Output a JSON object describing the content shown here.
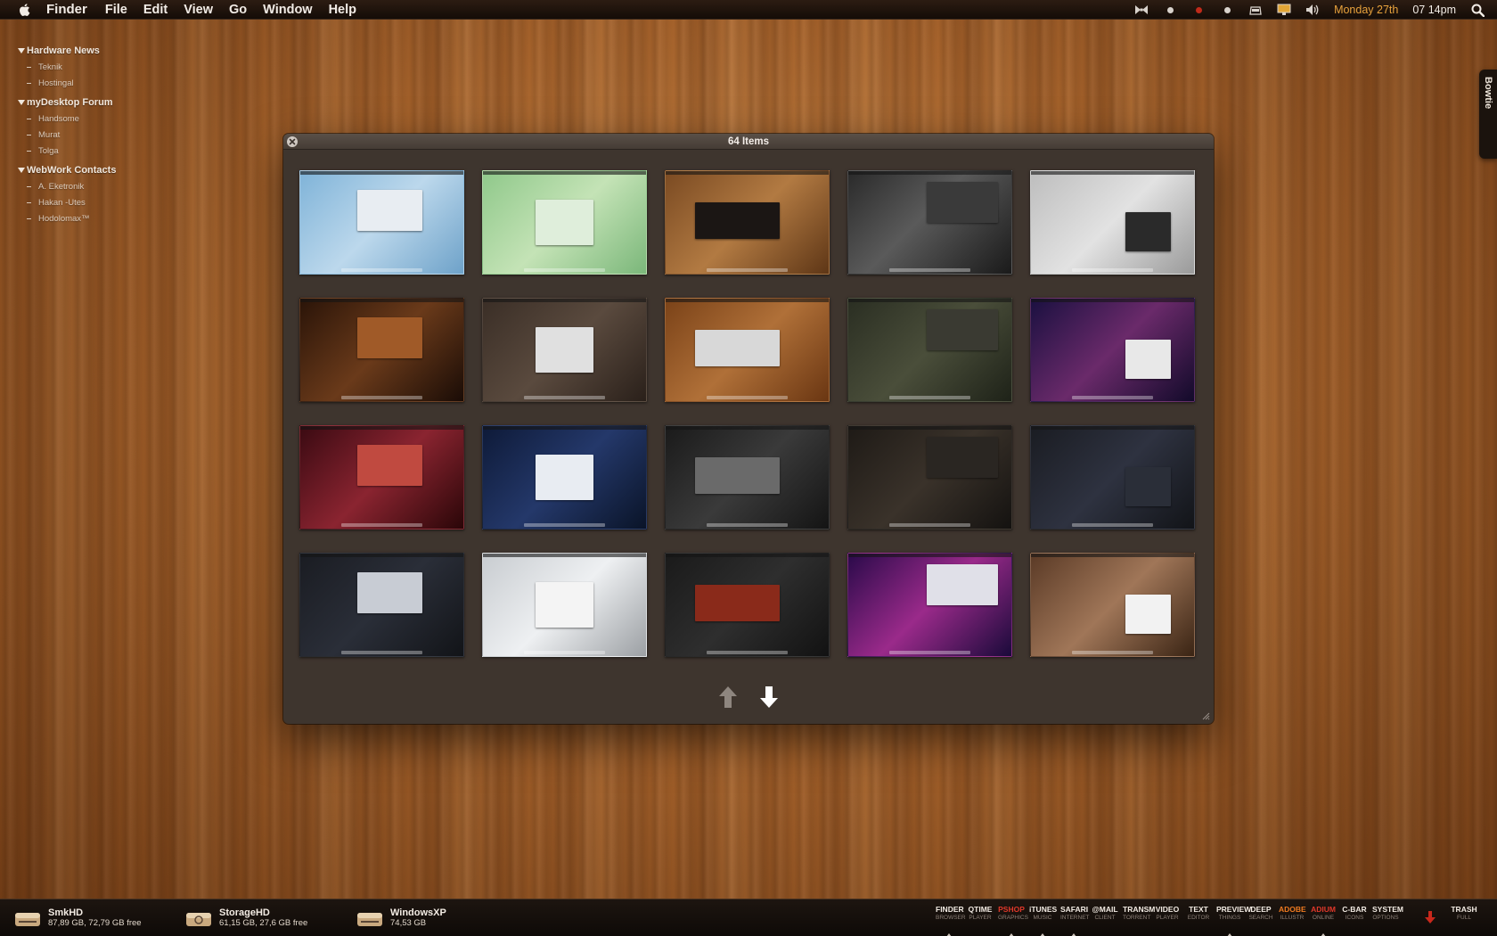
{
  "menubar": {
    "app": "Finder",
    "items": [
      "File",
      "Edit",
      "View",
      "Go",
      "Window",
      "Help"
    ],
    "date": "Monday 27th",
    "time": "07 14pm"
  },
  "sidebar": {
    "groups": [
      {
        "title": "Hardware News",
        "items": [
          "Teknik",
          "Hostingal"
        ]
      },
      {
        "title": "myDesktop Forum",
        "items": [
          "Handsome",
          "Murat",
          "Tolga"
        ]
      },
      {
        "title": "WebWork Contacts",
        "items": [
          "A. Eketronik",
          "Hakan -Utes",
          "Hodolomax™"
        ]
      }
    ]
  },
  "bowtie": {
    "label": "Bowtie"
  },
  "window": {
    "title": "64 Items"
  },
  "disks": [
    {
      "name": "SmkHD",
      "info": "87,89 GB, 72,79 GB free"
    },
    {
      "name": "StorageHD",
      "info": "61,15 GB, 27,6 GB free"
    },
    {
      "name": "WindowsXP",
      "info": "74,53 GB"
    }
  ],
  "dock": [
    {
      "n1": "FINDER",
      "n2": "BROWSER",
      "ind": true
    },
    {
      "n1": "QTIME",
      "n2": "PLAYER",
      "ind": false
    },
    {
      "n1": "PSHOP",
      "n2": "GRAPHICS",
      "ind": true,
      "color": "red"
    },
    {
      "n1": "iTUNES",
      "n2": "MUSIC",
      "ind": true
    },
    {
      "n1": "SAFARI",
      "n2": "INTERNET",
      "ind": true
    },
    {
      "n1": "@MAIL",
      "n2": "CLIENT",
      "ind": false
    },
    {
      "n1": "TRANSM",
      "n2": "TORRENT",
      "ind": false
    },
    {
      "n1": "VIDEO",
      "n2": "PLAYER",
      "ind": false
    },
    {
      "n1": "TEXT",
      "n2": "EDITOR",
      "ind": false
    },
    {
      "n1": "PREVIEW",
      "n2": "THINGS",
      "ind": true
    },
    {
      "n1": "DEEP",
      "n2": "SEARCH",
      "ind": false
    },
    {
      "n1": "ADOBE",
      "n2": "ILLUSTR",
      "ind": false,
      "color": "orange"
    },
    {
      "n1": "ADIUM",
      "n2": "ONLINE",
      "ind": true,
      "color": "red"
    },
    {
      "n1": "C-BAR",
      "n2": "ICONS",
      "ind": false
    },
    {
      "n1": "SYSTEM",
      "n2": "OPTIONS",
      "ind": false
    }
  ],
  "trash": {
    "n1": "TRASH",
    "n2": "FULL"
  },
  "thumbnails": [
    {
      "bg": "linear-gradient(135deg,#7fb3d8,#bcd8ec 50%,#6ea2c9)",
      "win": "#e8edf2"
    },
    {
      "bg": "linear-gradient(135deg,#8fc88a,#c4e3b6 50%,#7bb77a)",
      "win": "#dfeedb"
    },
    {
      "bg": "linear-gradient(135deg,#7a4a22,#b27a42 50%,#5e3616)",
      "win": "#1b1614"
    },
    {
      "bg": "linear-gradient(135deg,#2a2a2a,#5a5a5a 45%,#1a1a1a)",
      "win": "#3a3a3a"
    },
    {
      "bg": "linear-gradient(135deg,#bdbdbd,#e2e2e2 50%,#9a9a9a)",
      "win": "#2a2a2a"
    },
    {
      "bg": "linear-gradient(135deg,#2a1408,#6a3a1a 50%,#1a0c06)",
      "win": "#a05a28"
    },
    {
      "bg": "linear-gradient(135deg,#3a2e26,#5a4a3e 50%,#2a201a)",
      "win": "#e0e0e0"
    },
    {
      "bg": "linear-gradient(135deg,#7a4218,#b07038 50%,#6a3612)",
      "win": "#d8d8d8"
    },
    {
      "bg": "linear-gradient(135deg,#2a2e22,#4a4e3a 50%,#1e2218)",
      "win": "#3a3a32"
    },
    {
      "bg": "linear-gradient(135deg,#1a1040,#6a2a6a 50%,#120a2a)",
      "win": "#e8e8e8"
    },
    {
      "bg": "linear-gradient(135deg,#3a0a12,#8a2430 50%,#2a0608)",
      "win": "#c04a40"
    },
    {
      "bg": "linear-gradient(135deg,#0e1a38,#24386a 50%,#0a1428)",
      "win": "#e8ecf2"
    },
    {
      "bg": "linear-gradient(135deg,#1a1a1a,#3a3a3a 50%,#141414)",
      "win": "#6a6a6a"
    },
    {
      "bg": "linear-gradient(135deg,#1e1a16,#3a322a 50%,#141210)",
      "win": "#2a2622"
    },
    {
      "bg": "linear-gradient(135deg,#1a1c22,#2e3240 50%,#121418)",
      "win": "#2a2e38"
    },
    {
      "bg": "linear-gradient(135deg,#1a1c22,#2a2e38 50%,#121418)",
      "win": "#c8ccd4"
    },
    {
      "bg": "linear-gradient(135deg,#c8ccd0,#eef0f2 50%,#9ca0a4)",
      "win": "#f4f4f4"
    },
    {
      "bg": "linear-gradient(135deg,#1a1a1a,#2e2e2e 50%,#121212)",
      "win": "#8a2a1a"
    },
    {
      "bg": "linear-gradient(135deg,#2a0a4a,#9a2a8a 50%,#1a0a3a)",
      "win": "#e0e0e8"
    },
    {
      "bg": "linear-gradient(135deg,#5a3a26,#a07658 50%,#3a2414)",
      "win": "#f2f2f2"
    }
  ]
}
